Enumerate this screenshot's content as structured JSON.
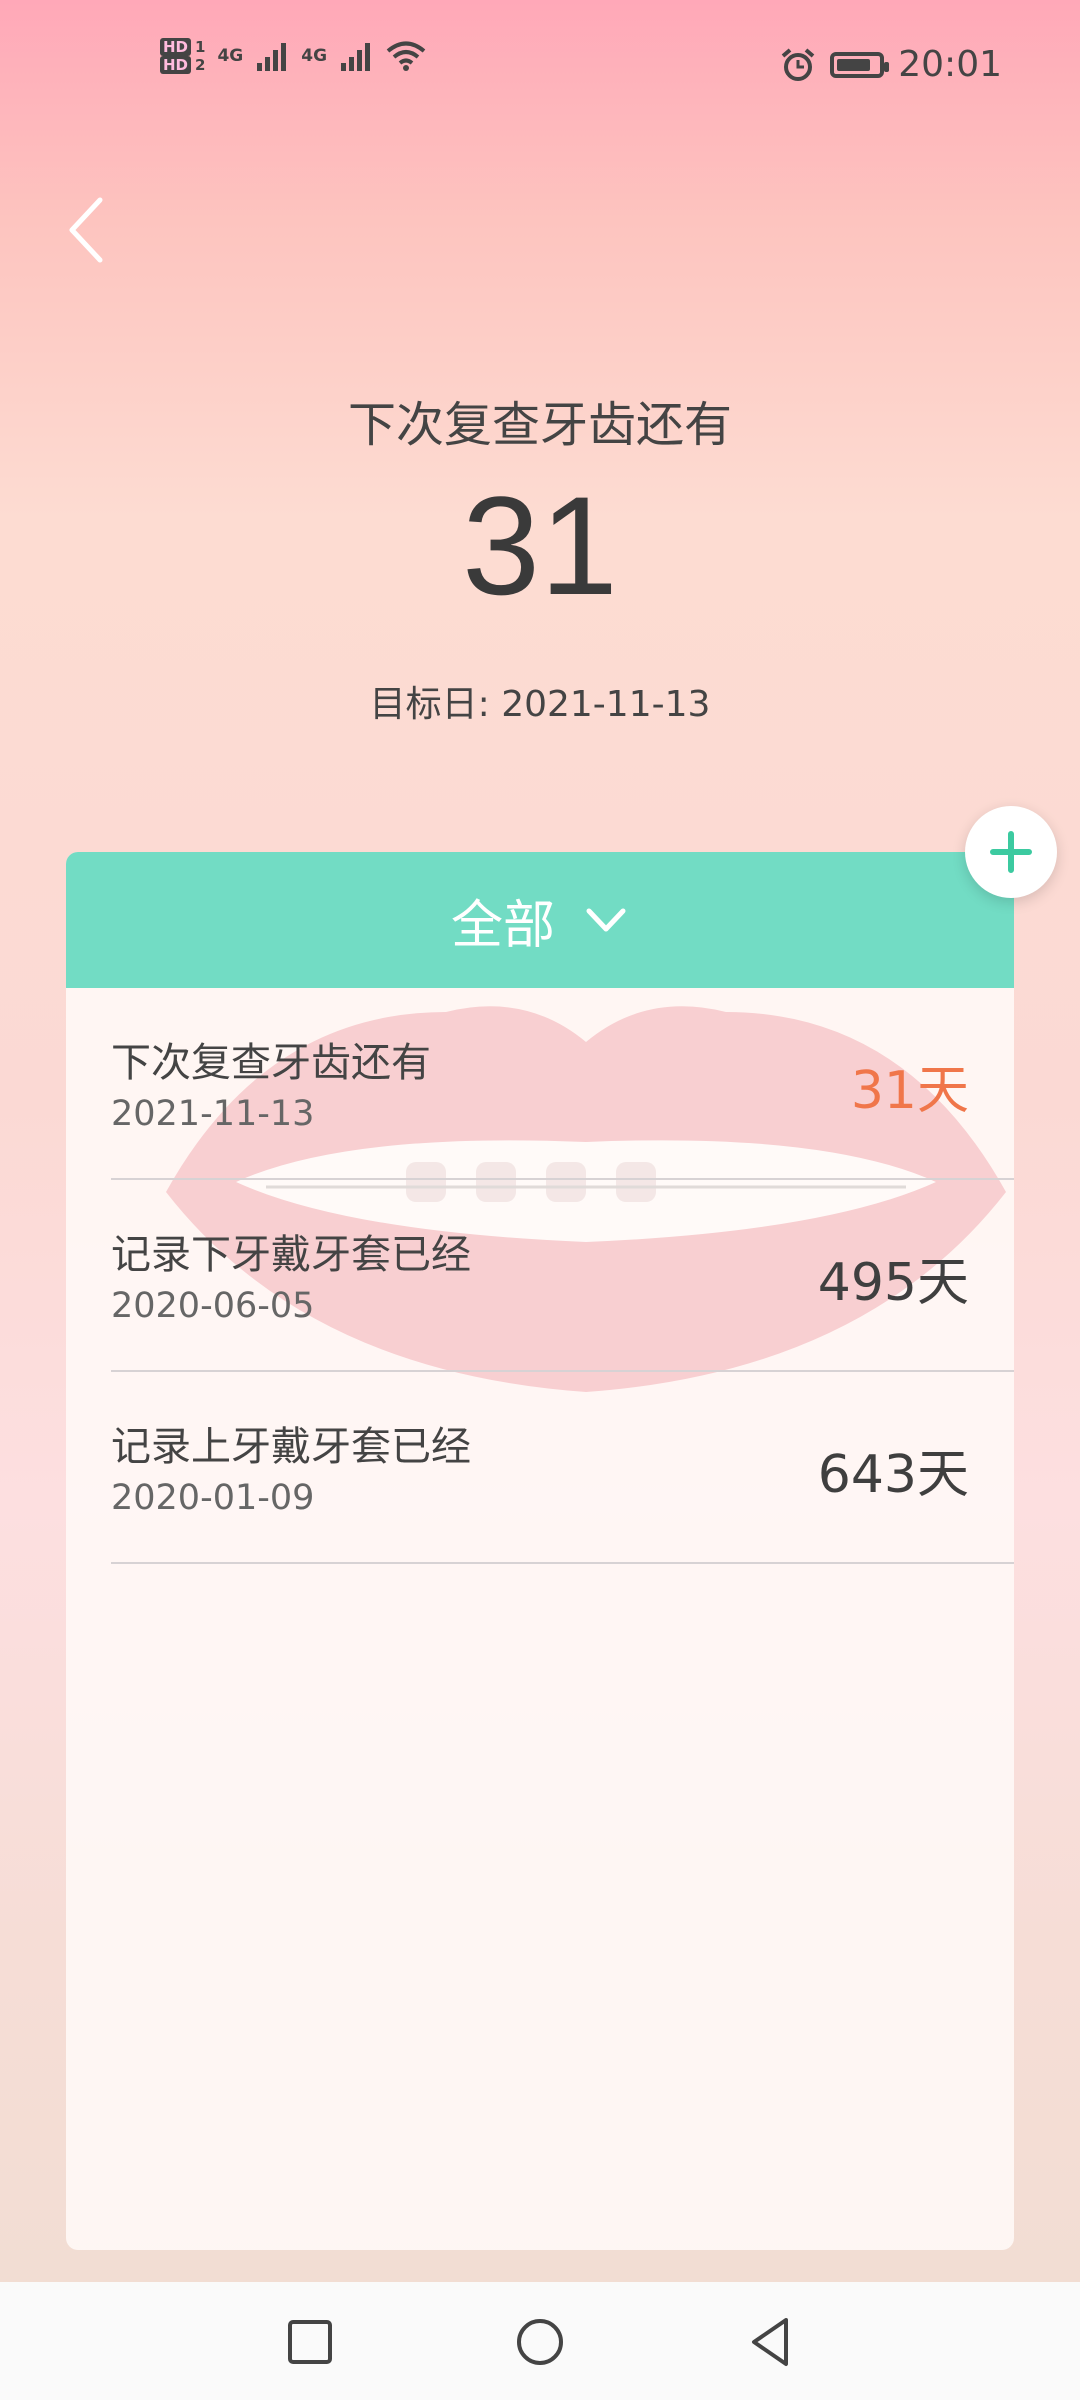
{
  "status_bar": {
    "hd1": "HD",
    "hd1_sim": "1",
    "hd2": "HD",
    "hd2_sim": "2",
    "net1": "4G",
    "net2": "4G",
    "time": "20:01",
    "battery_level": 0.85
  },
  "header": {
    "title": "下次复查牙齿还有",
    "count": "31",
    "target_label": "目标日:",
    "target_date": "2021-11-13"
  },
  "card": {
    "filter_label": "全部",
    "items": [
      {
        "title": "下次复查牙齿还有",
        "date": "2021-11-13",
        "days": "31天",
        "highlight": true
      },
      {
        "title": "记录下牙戴牙套已经",
        "date": "2020-06-05",
        "days": "495天",
        "highlight": false
      },
      {
        "title": "记录上牙戴牙套已经",
        "date": "2020-01-09",
        "days": "643天",
        "highlight": false
      }
    ]
  },
  "colors": {
    "accent": "#72dcc4",
    "highlight": "#f0764a"
  }
}
